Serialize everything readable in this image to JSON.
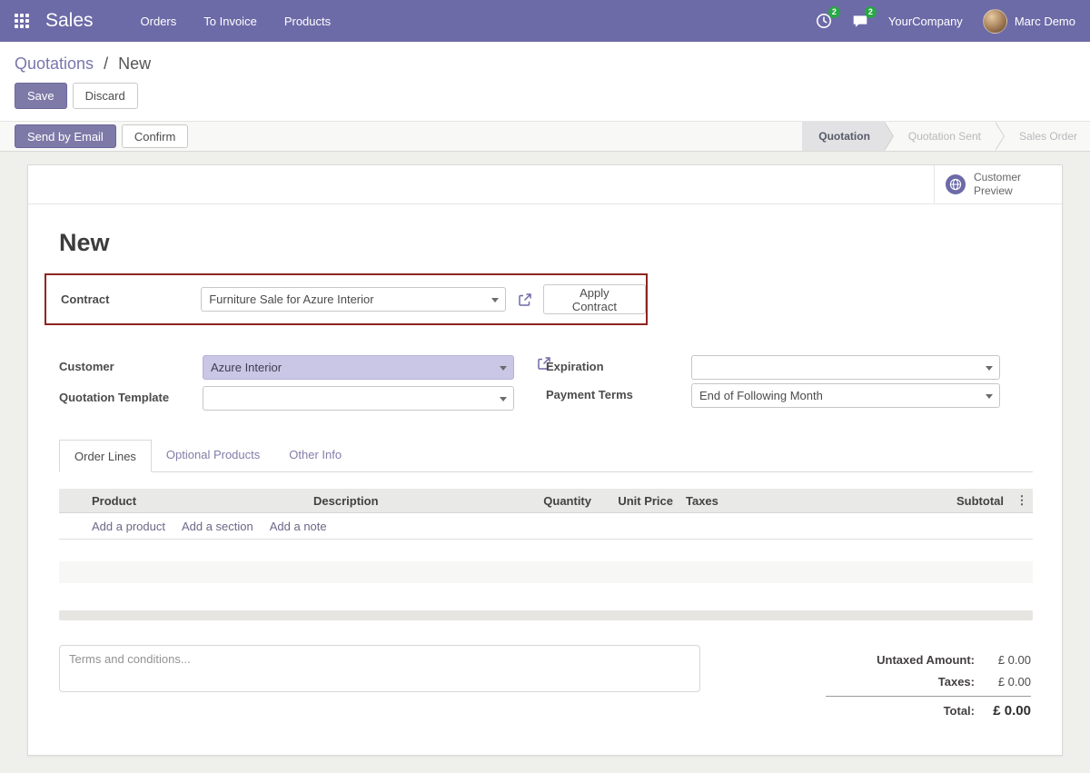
{
  "colors": {
    "brand": "#6d6aa8",
    "badge_green": "#28a745",
    "highlight_red": "#8f2420",
    "customer_field_bg": "#cac7e6"
  },
  "navbar": {
    "app_name": "Sales",
    "menu_items": [
      {
        "label": "Orders"
      },
      {
        "label": "To Invoice"
      },
      {
        "label": "Products"
      }
    ],
    "activities_badge": "2",
    "messages_badge": "2",
    "company": "YourCompany",
    "user": "Marc Demo"
  },
  "breadcrumb": {
    "parent": "Quotations",
    "separator": "/",
    "current": "New"
  },
  "actions": {
    "save": "Save",
    "discard": "Discard"
  },
  "statusbar": {
    "send_by_email": "Send by Email",
    "confirm": "Confirm",
    "steps": [
      {
        "label": "Quotation",
        "active": true
      },
      {
        "label": "Quotation Sent",
        "active": false
      },
      {
        "label": "Sales Order",
        "active": false
      }
    ]
  },
  "sheet": {
    "customer_preview": "Customer Preview",
    "title": "New",
    "contract": {
      "label": "Contract",
      "value": "Furniture Sale for Azure Interior",
      "apply_button": "Apply Contract"
    },
    "fields": {
      "customer_label": "Customer",
      "customer_value": "Azure Interior",
      "quotation_template_label": "Quotation Template",
      "quotation_template_value": "",
      "expiration_label": "Expiration",
      "expiration_value": "",
      "payment_terms_label": "Payment Terms",
      "payment_terms_value": "End of Following Month"
    },
    "tabs": [
      {
        "label": "Order Lines",
        "active": true
      },
      {
        "label": "Optional Products",
        "active": false
      },
      {
        "label": "Other Info",
        "active": false
      }
    ],
    "table": {
      "headers": [
        "Product",
        "Description",
        "Quantity",
        "Unit Price",
        "Taxes",
        "Subtotal"
      ],
      "add_links": [
        "Add a product",
        "Add a section",
        "Add a note"
      ]
    },
    "terms_placeholder": "Terms and conditions...",
    "totals": {
      "untaxed_label": "Untaxed Amount:",
      "untaxed_value": "£ 0.00",
      "taxes_label": "Taxes:",
      "taxes_value": "£ 0.00",
      "total_label": "Total:",
      "total_value": "£ 0.00"
    }
  },
  "icons": {
    "kebab": "⋮"
  }
}
